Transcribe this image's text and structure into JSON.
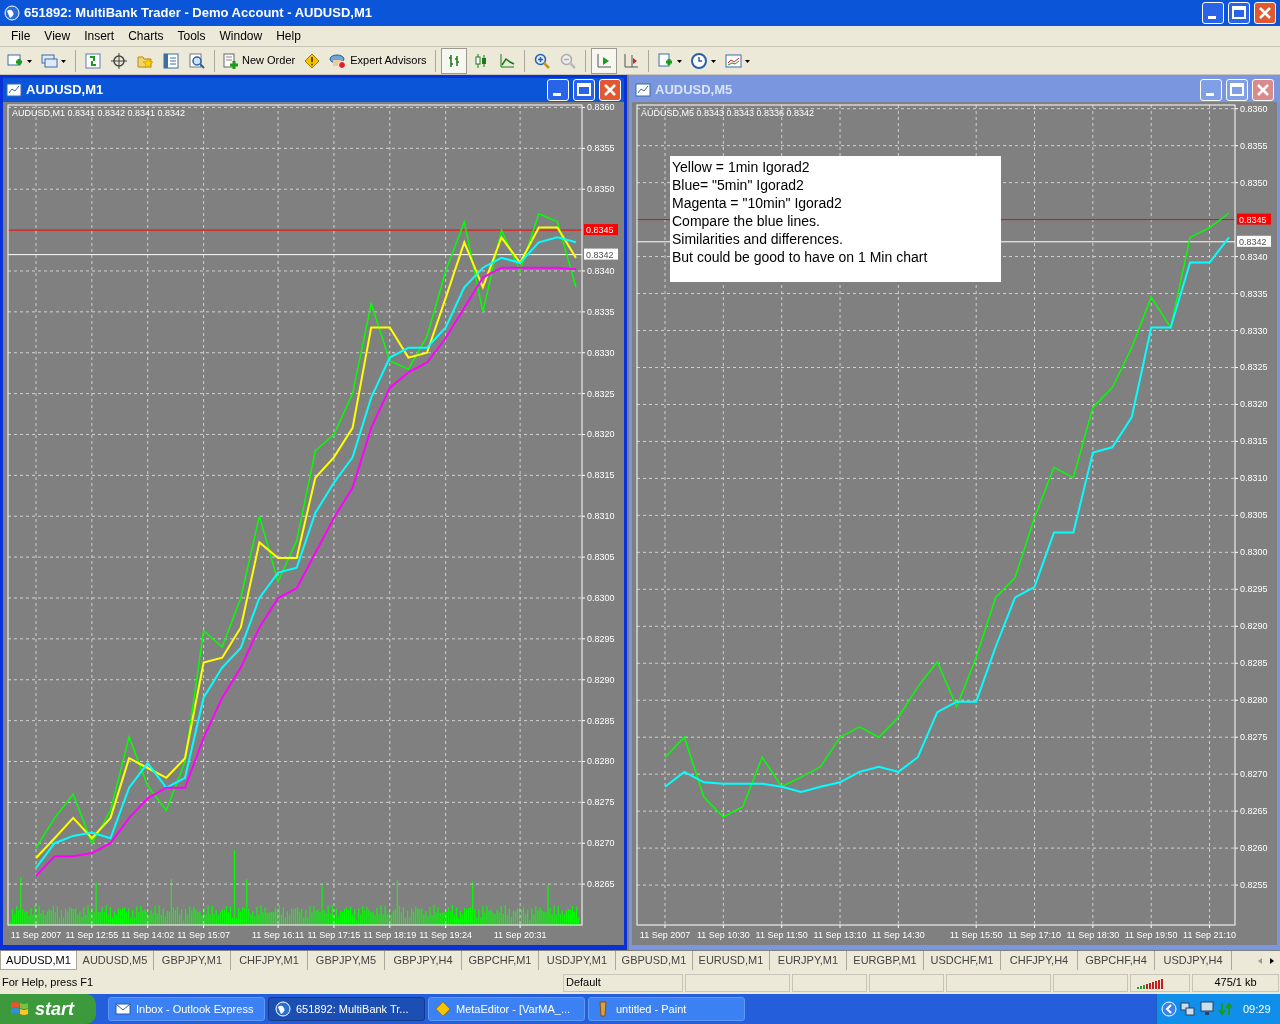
{
  "window": {
    "title": "651892: MultiBank Trader - Demo Account - AUDUSD,M1"
  },
  "menu": [
    "File",
    "View",
    "Insert",
    "Charts",
    "Tools",
    "Window",
    "Help"
  ],
  "toolbar": {
    "buttons": [
      "New Order",
      "Expert Advisors"
    ]
  },
  "charts": [
    {
      "title": "AUDUSD,M1",
      "active": true,
      "header": "AUDUSD,M1 0.8341 0.8342 0.8341 0.8342",
      "volume": true,
      "chart_data": {
        "type": "line",
        "categories": [
          "11 Sep 2007",
          null,
          null,
          "11 Sep 12:55",
          null,
          null,
          "11 Sep 14:02",
          null,
          null,
          "11 Sep 15:07",
          null,
          null,
          null,
          "11 Sep 16:11",
          null,
          null,
          "11 Sep 17:15",
          null,
          null,
          "11 Sep 18:19",
          null,
          null,
          "11 Sep 19:24",
          null,
          null,
          null,
          "11 Sep 20:31",
          null,
          null,
          null
        ],
        "ylim": [
          0.826,
          0.83603
        ],
        "grid": true,
        "ref_lines": [
          {
            "axis": "y",
            "value": 0.8345,
            "label": "0.8345",
            "color": "#ff0000"
          },
          {
            "axis": "y",
            "value": 0.8342,
            "label": "0.8342",
            "color": "#ffffff"
          }
        ],
        "yticks": [
          {
            "value": 0.836,
            "label": "0.8360"
          },
          {
            "value": 0.8355,
            "label": "0.8355"
          },
          {
            "value": 0.835,
            "label": "0.8350"
          },
          {
            "value": 0.834,
            "label": "0.8340"
          },
          {
            "value": 0.8335,
            "label": "0.8335"
          },
          {
            "value": 0.833,
            "label": "0.8330"
          },
          {
            "value": 0.8325,
            "label": "0.8325"
          },
          {
            "value": 0.832,
            "label": "0.8320"
          },
          {
            "value": 0.8315,
            "label": "0.8315"
          },
          {
            "value": 0.831,
            "label": "0.8310"
          },
          {
            "value": 0.8305,
            "label": "0.8305"
          },
          {
            "value": 0.83,
            "label": "0.8300"
          },
          {
            "value": 0.8295,
            "label": "0.8295"
          },
          {
            "value": 0.829,
            "label": "0.8290"
          },
          {
            "value": 0.8285,
            "label": "0.8285"
          },
          {
            "value": 0.828,
            "label": "0.8280"
          },
          {
            "value": 0.8275,
            "label": "0.8275"
          },
          {
            "value": 0.827,
            "label": "0.8270"
          },
          {
            "value": 0.8265,
            "label": "0.8265"
          }
        ],
        "series": [
          {
            "color": "#00ff00",
            "values": [
              0.82694,
              0.82731,
              0.8276,
              0.827,
              0.8274,
              0.8283,
              0.8277,
              0.8274,
              0.828,
              0.8296,
              0.8294,
              0.83,
              0.831,
              0.8302,
              0.8307,
              0.8318,
              0.832,
              0.8325,
              0.8336,
              0.8329,
              0.8328,
              0.8332,
              0.834,
              0.8346,
              0.8335,
              0.8345,
              0.834,
              0.8347,
              0.8346,
              0.8338
            ]
          },
          {
            "color": "#ffff00",
            "values": [
              0.82682,
              0.82706,
              0.82731,
              0.82706,
              0.82731,
              0.82804,
              0.82792,
              0.8278,
              0.82804,
              0.82921,
              0.82927,
              0.82964,
              0.83068,
              0.83049,
              0.83049,
              0.83147,
              0.83172,
              0.83208,
              0.83331,
              0.83331,
              0.83294,
              0.833,
              0.83367,
              0.83435,
              0.8338,
              0.83441,
              0.8341,
              0.83453,
              0.83453,
              0.83416
            ]
          },
          {
            "color": "#00ffff",
            "values": [
              0.8267,
              0.827,
              0.82709,
              0.82713,
              0.82706,
              0.82768,
              0.82798,
              0.82768,
              0.8278,
              0.82878,
              0.82915,
              0.82939,
              0.83,
              0.83031,
              0.83037,
              0.83104,
              0.83141,
              0.83172,
              0.83245,
              0.83294,
              0.83306,
              0.83306,
              0.83331,
              0.8338,
              0.83404,
              0.83416,
              0.8341,
              0.83435,
              0.83441,
              0.83435
            ]
          },
          {
            "color": "#ff00ff",
            "values": [
              0.8266,
              0.82684,
              0.82684,
              0.82688,
              0.827,
              0.82731,
              0.82755,
              0.82768,
              0.82768,
              0.82829,
              0.82878,
              0.82915,
              0.82964,
              0.83,
              0.83012,
              0.83055,
              0.83098,
              0.83135,
              0.83208,
              0.83257,
              0.83276,
              0.83288,
              0.83318,
              0.83355,
              0.83392,
              0.83404,
              0.83404,
              0.83404,
              0.83404,
              0.83402
            ]
          }
        ]
      }
    },
    {
      "title": "AUDUSD,M5",
      "active": false,
      "header": "AUDUSD,M5 0.8343 0.8343 0.8336 0.8342",
      "note": [
        "Yellow = 1min Igorad2",
        "Blue= \"5min\" Igorad2",
        "Magenta = \"10min\" Igorad2",
        "Compare the blue lines.",
        "Similarities and differences.",
        "But could be good to have on 1 Min chart"
      ],
      "chart_data": {
        "type": "line",
        "categories": [
          "11 Sep 2007",
          null,
          null,
          "11 Sep 10:30",
          null,
          null,
          "11 Sep 11:50",
          null,
          null,
          "11 Sep 13:10",
          null,
          null,
          "11 Sep 14:30",
          null,
          null,
          null,
          "11 Sep 15:50",
          null,
          null,
          "11 Sep 17:10",
          null,
          null,
          "11 Sep 18:30",
          null,
          null,
          "11 Sep 19:50",
          null,
          null,
          "11 Sep 21:10",
          null
        ],
        "ylim": [
          0.82496,
          0.83605
        ],
        "grid": true,
        "ref_lines": [
          {
            "axis": "y",
            "value": 0.8345,
            "label": "0.8345",
            "color": "#ff0000"
          },
          {
            "axis": "y",
            "value": 0.8342,
            "label": "0.8342",
            "color": "#ffffff"
          }
        ],
        "yticks": [
          {
            "value": 0.836,
            "label": "0.8360"
          },
          {
            "value": 0.8355,
            "label": "0.8355"
          },
          {
            "value": 0.835,
            "label": "0.8350"
          },
          {
            "value": 0.834,
            "label": "0.8340"
          },
          {
            "value": 0.8335,
            "label": "0.8335"
          },
          {
            "value": 0.833,
            "label": "0.8330"
          },
          {
            "value": 0.8325,
            "label": "0.8325"
          },
          {
            "value": 0.832,
            "label": "0.8320"
          },
          {
            "value": 0.8315,
            "label": "0.8315"
          },
          {
            "value": 0.831,
            "label": "0.8310"
          },
          {
            "value": 0.8305,
            "label": "0.8305"
          },
          {
            "value": 0.83,
            "label": "0.8300"
          },
          {
            "value": 0.8295,
            "label": "0.8295"
          },
          {
            "value": 0.829,
            "label": "0.8290"
          },
          {
            "value": 0.8285,
            "label": "0.8285"
          },
          {
            "value": 0.828,
            "label": "0.8280"
          },
          {
            "value": 0.8275,
            "label": "0.8275"
          },
          {
            "value": 0.827,
            "label": "0.8270"
          },
          {
            "value": 0.8265,
            "label": "0.8265"
          },
          {
            "value": 0.826,
            "label": "0.8260"
          },
          {
            "value": 0.8255,
            "label": "0.8255"
          }
        ],
        "series": [
          {
            "color": "#00ff00",
            "values": [
              0.82723,
              0.8275,
              0.82669,
              0.82642,
              0.82656,
              0.82723,
              0.82683,
              0.82696,
              0.8271,
              0.8275,
              0.82764,
              0.8275,
              0.82777,
              0.82818,
              0.82852,
              0.82791,
              0.82858,
              0.82939,
              0.82966,
              0.83047,
              0.83115,
              0.83101,
              0.83196,
              0.83223,
              0.83277,
              0.83345,
              0.83304,
              0.83426,
              0.83439,
              0.83459
            ]
          },
          {
            "color": "#00ffff",
            "values": [
              0.82683,
              0.82703,
              0.82689,
              0.82687,
              0.82687,
              0.82687,
              0.82683,
              0.82676,
              0.82683,
              0.82689,
              0.82703,
              0.8271,
              0.82703,
              0.82723,
              0.82784,
              0.82798,
              0.82798,
              0.82872,
              0.82939,
              0.82953,
              0.83027,
              0.83027,
              0.83135,
              0.83142,
              0.83183,
              0.83304,
              0.83304,
              0.83392,
              0.83392,
              0.83426
            ]
          }
        ]
      }
    }
  ],
  "tabs": [
    {
      "label": "AUDUSD,M1",
      "selected": true
    },
    {
      "label": "AUDUSD,M5",
      "selected": false
    },
    {
      "label": "GBPJPY,M1",
      "selected": false
    },
    {
      "label": "CHFJPY,M1",
      "selected": false
    },
    {
      "label": "GBPJPY,M5",
      "selected": false
    },
    {
      "label": "GBPJPY,H4",
      "selected": false
    },
    {
      "label": "GBPCHF,M1",
      "selected": false
    },
    {
      "label": "USDJPY,M1",
      "selected": false
    },
    {
      "label": "GBPUSD,M1",
      "selected": false
    },
    {
      "label": "EURUSD,M1",
      "selected": false
    },
    {
      "label": "EURJPY,M1",
      "selected": false
    },
    {
      "label": "EURGBP,M1",
      "selected": false
    },
    {
      "label": "USDCHF,M1",
      "selected": false
    },
    {
      "label": "CHFJPY,H4",
      "selected": false
    },
    {
      "label": "GBPCHF,H4",
      "selected": false
    },
    {
      "label": "USDJPY,H4",
      "selected": false
    }
  ],
  "status_bar": {
    "help": "For Help, press F1",
    "profile": "Default",
    "traffic": "475/1 kb"
  },
  "taskbar": {
    "start": "start",
    "tasks": [
      {
        "label": "Inbox - Outlook Express",
        "selected": false
      },
      {
        "label": "651892: MultiBank Tr...",
        "selected": true
      },
      {
        "label": "MetaEditor - [VarMA_...",
        "selected": false
      },
      {
        "label": "untitled - Paint",
        "selected": false
      }
    ],
    "clock": "09:29"
  }
}
